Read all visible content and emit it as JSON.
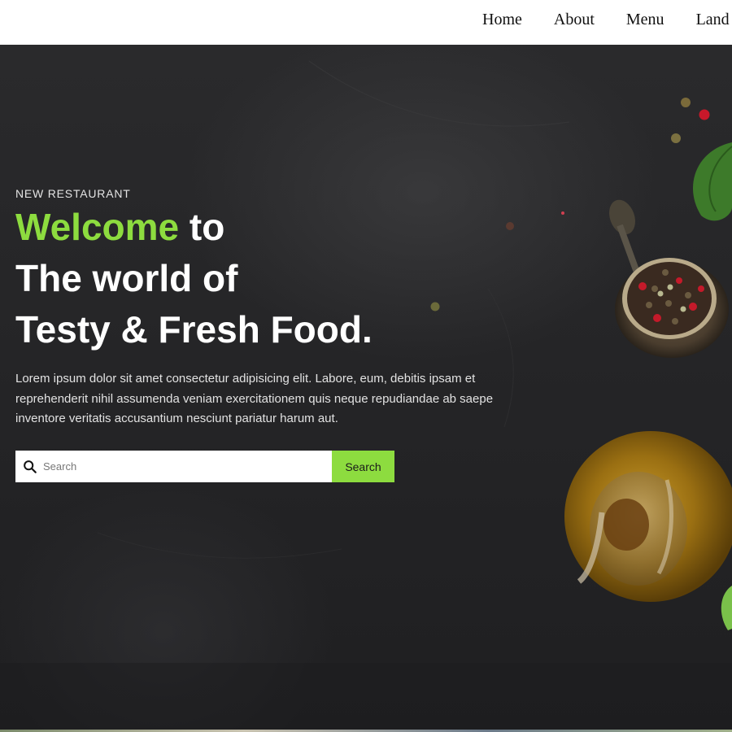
{
  "nav": {
    "items": [
      "Home",
      "About",
      "Menu",
      "Land"
    ]
  },
  "hero": {
    "eyebrow": "NEW RESTAURANT",
    "headline_accent": "Welcome",
    "headline_rest_1": " to",
    "headline_line_2": "The world of",
    "headline_line_3": "Testy & Fresh Food.",
    "description": "Lorem ipsum dolor sit amet consectetur adipisicing elit. Labore, eum, debitis ipsam et reprehenderit nihil assumenda veniam exercitationem quis neque repudiandae ab saepe inventore veritatis accusantium nesciunt pariatur harum aut.",
    "background_image": "dark stone surface with spices, basil leaves, peppercorn jar and olive oil jug"
  },
  "search": {
    "placeholder": "Search",
    "value": "",
    "button_label": "Search"
  },
  "colors": {
    "accent": "#8ddc3f",
    "hero_bg": "#252527",
    "text_light": "#e2e2e2"
  },
  "icons": {
    "search": "magnifier-icon"
  }
}
